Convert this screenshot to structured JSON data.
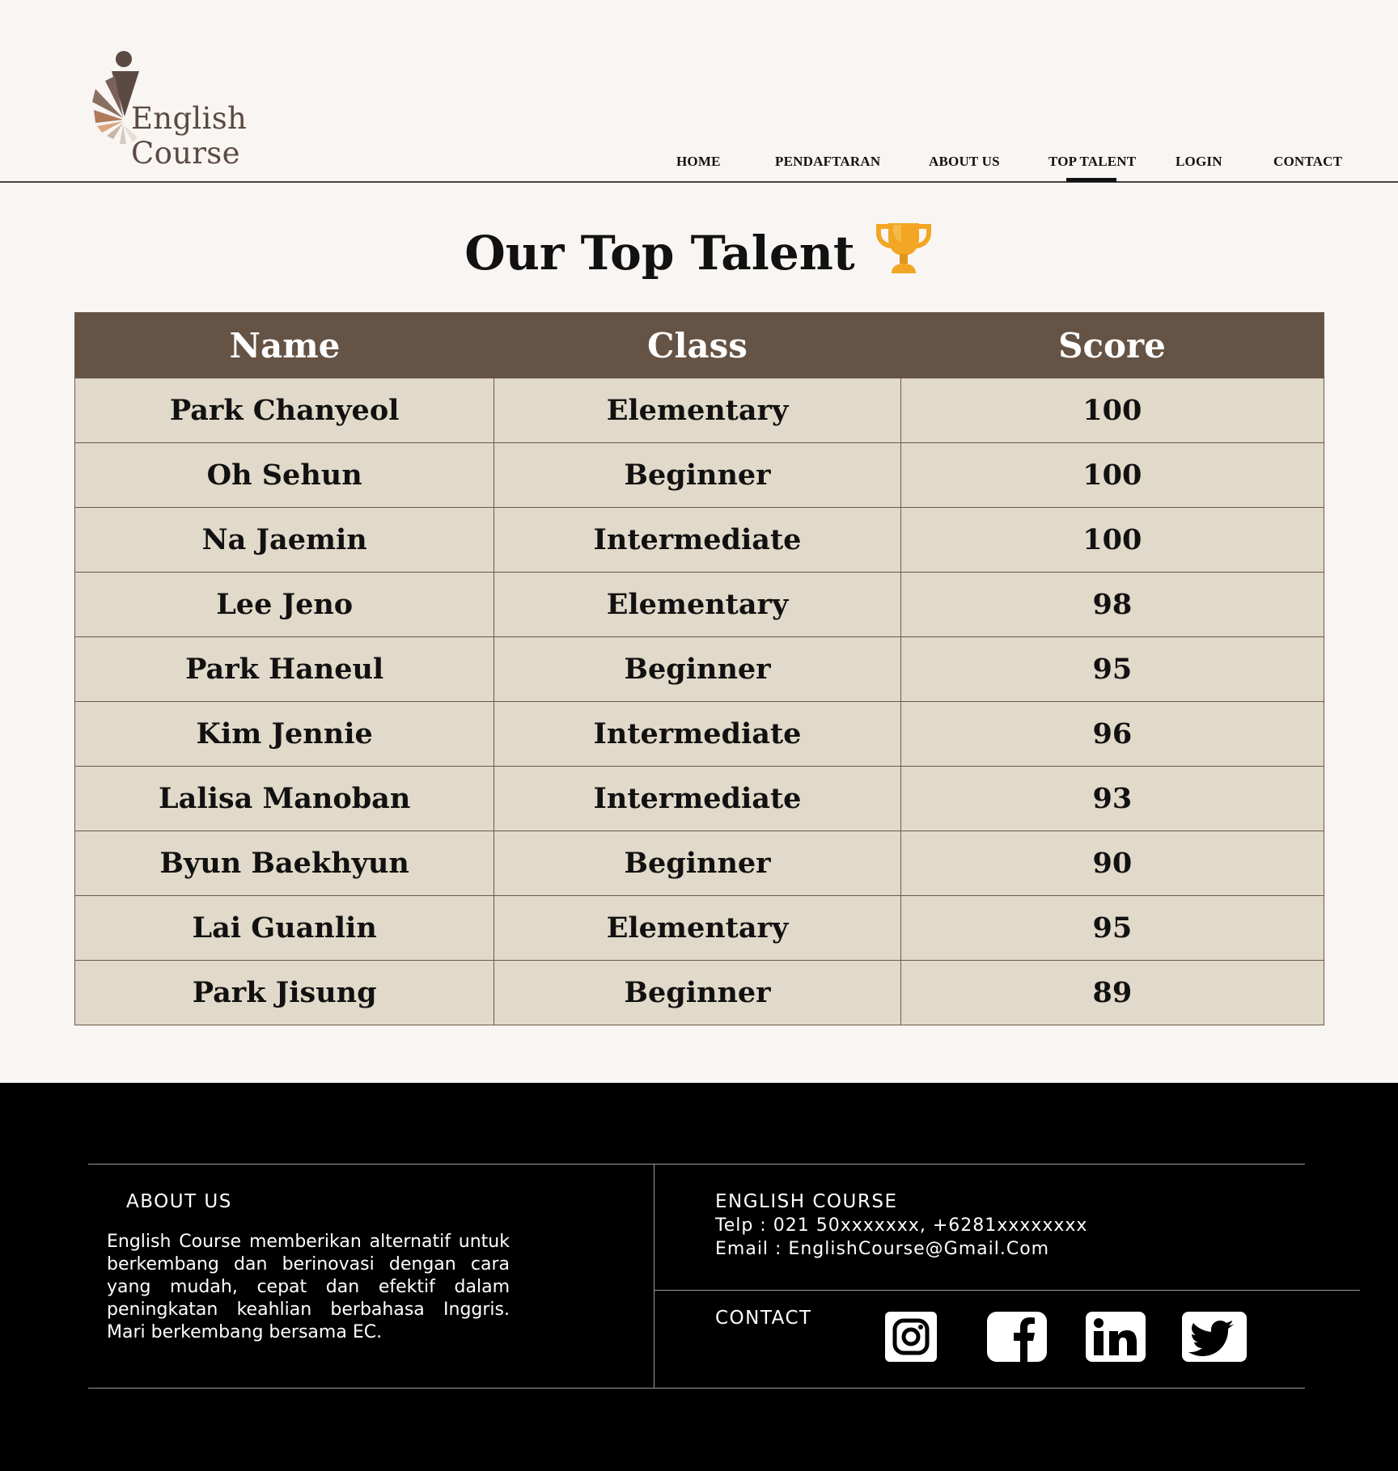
{
  "brand": {
    "logo_text": "English Course"
  },
  "nav": {
    "items": [
      {
        "label": "HOME"
      },
      {
        "label": "PENDAFTARAN"
      },
      {
        "label": "ABOUT US"
      },
      {
        "label": "TOP TALENT",
        "active": true
      },
      {
        "label": "LOGIN"
      },
      {
        "label": "CONTACT"
      }
    ]
  },
  "main": {
    "title": "Our Top Talent",
    "table": {
      "headers": [
        "Name",
        "Class",
        "Score"
      ],
      "rows": [
        [
          "Park Chanyeol",
          "Elementary",
          "100"
        ],
        [
          "Oh Sehun",
          "Beginner",
          "100"
        ],
        [
          "Na Jaemin",
          "Intermediate",
          "100"
        ],
        [
          "Lee Jeno",
          "Elementary",
          "98"
        ],
        [
          "Park Haneul",
          "Beginner",
          "95"
        ],
        [
          "Kim Jennie",
          "Intermediate",
          "96"
        ],
        [
          "Lalisa Manoban",
          "Intermediate",
          "93"
        ],
        [
          "Byun Baekhyun",
          "Beginner",
          "90"
        ],
        [
          "Lai Guanlin",
          "Elementary",
          "95"
        ],
        [
          "Park Jisung",
          "Beginner",
          "89"
        ]
      ]
    }
  },
  "footer": {
    "about_heading": "ABOUT US",
    "about_text": "English Course memberikan alternatif untuk berkembang dan berinovasi dengan cara yang mudah, cepat dan efektif dalam peningkatan keahlian berbahasa Inggris. Mari berkembang bersama EC.",
    "company_heading": "ENGLISH COURSE",
    "telp": "Telp : 021 50xxxxxxx, +6281xxxxxxxx",
    "email": "Email : EnglishCourse@Gmail.Com",
    "contact_heading": "CONTACT",
    "social_icons": [
      "instagram-icon",
      "facebook-icon",
      "linkedin-icon",
      "twitter-icon"
    ]
  },
  "colors": {
    "page_bg": "#f8f5f3",
    "table_header_bg": "#655345",
    "table_row_bg": "#e1d9c9",
    "footer_bg": "#000000",
    "trophy": "#f2a623"
  }
}
